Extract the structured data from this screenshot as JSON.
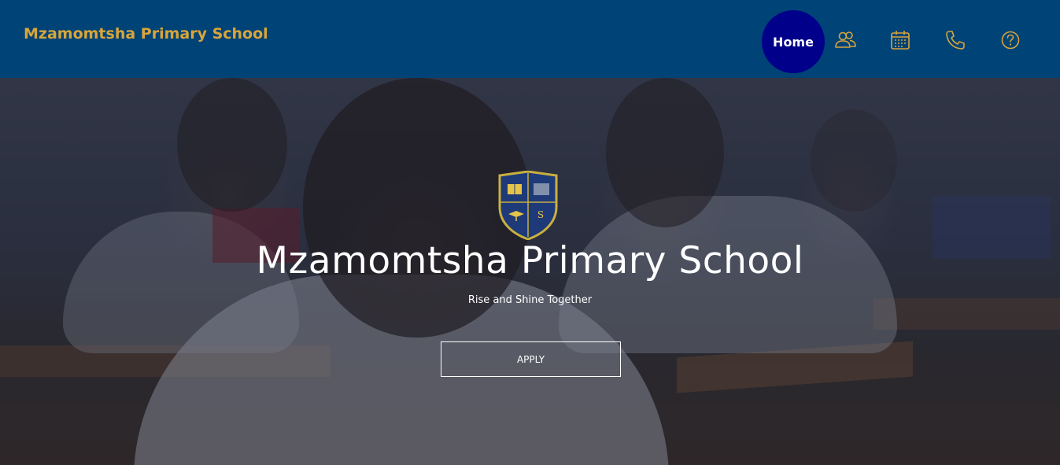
{
  "header": {
    "brand": "Mzamomtsha Primary School",
    "nav": {
      "home_label": "Home",
      "icons": [
        "people-icon",
        "calendar-icon",
        "phone-icon",
        "help-icon"
      ]
    }
  },
  "hero": {
    "title": "Mzamomtsha Primary School",
    "tagline": "Rise and Shine Together",
    "apply_label": "APPLY"
  },
  "colors": {
    "header_bg": "#004376",
    "brand_gold": "#d9a53a",
    "home_active": "#00008a",
    "white": "#ffffff"
  }
}
